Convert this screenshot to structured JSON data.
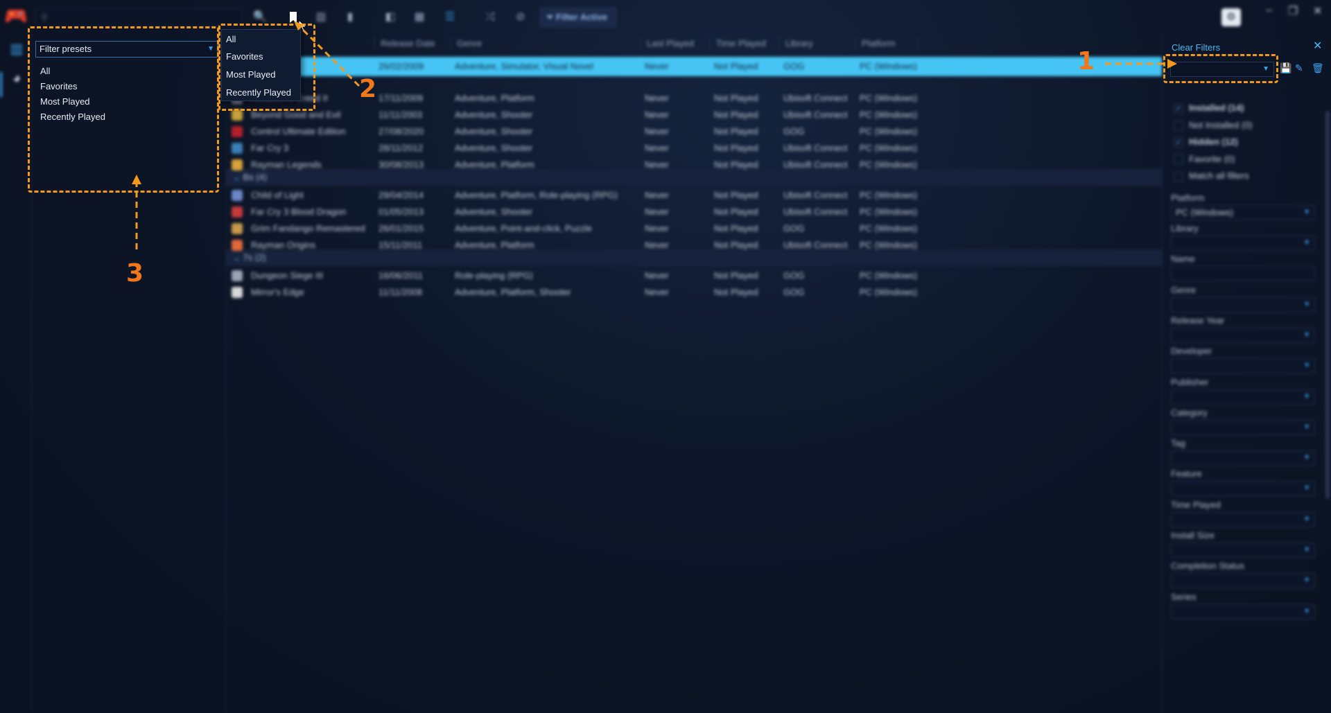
{
  "toolbar": {
    "filter_active_label": "Filter Active"
  },
  "grid": {
    "columns": [
      "Release Date",
      "Genre",
      "Last Played",
      "Time Played",
      "Library",
      "Platform"
    ],
    "groups": [
      {
        "label": "Bs (4)"
      },
      {
        "label": "7s (2)"
      }
    ],
    "selected_row": {
      "name": "… ROAM",
      "release": "26/02/2009",
      "genre": "Adventure, Simulator, Visual Novel",
      "last": "Never",
      "time": "Not Played",
      "library": "GOG",
      "platform": "PC (Windows)"
    },
    "rows_group1": [
      {
        "name": "Assassin's Creed II",
        "release": "17/11/2009",
        "genre": "Adventure, Platform",
        "last": "Never",
        "time": "Not Played",
        "library": "Ubisoft Connect",
        "platform": "PC (Windows)",
        "color": "#8c93a3"
      },
      {
        "name": "Beyond Good and Evil",
        "release": "11/11/2003",
        "genre": "Adventure, Shooter",
        "last": "Never",
        "time": "Not Played",
        "library": "Ubisoft Connect",
        "platform": "PC (Windows)",
        "color": "#c7a23a"
      },
      {
        "name": "Control Ultimate Edition",
        "release": "27/08/2020",
        "genre": "Adventure, Shooter",
        "last": "Never",
        "time": "Not Played",
        "library": "GOG",
        "platform": "PC (Windows)",
        "color": "#b3202a"
      },
      {
        "name": "Far Cry 3",
        "release": "28/11/2012",
        "genre": "Adventure, Shooter",
        "last": "Never",
        "time": "Not Played",
        "library": "Ubisoft Connect",
        "platform": "PC (Windows)",
        "color": "#3a7fb8"
      },
      {
        "name": "Rayman Legends",
        "release": "30/08/2013",
        "genre": "Adventure, Platform",
        "last": "Never",
        "time": "Not Played",
        "library": "Ubisoft Connect",
        "platform": "PC (Windows)",
        "color": "#d9a23a"
      }
    ],
    "rows_group2": [
      {
        "name": "Child of Light",
        "release": "29/04/2014",
        "genre": "Adventure, Platform, Role-playing (RPG)",
        "last": "Never",
        "time": "Not Played",
        "library": "Ubisoft Connect",
        "platform": "PC (Windows)",
        "color": "#6c86c7"
      },
      {
        "name": "Far Cry 3 Blood Dragon",
        "release": "01/05/2013",
        "genre": "Adventure, Shooter",
        "last": "Never",
        "time": "Not Played",
        "library": "Ubisoft Connect",
        "platform": "PC (Windows)",
        "color": "#c43a3a"
      },
      {
        "name": "Grim Fandango Remastered",
        "release": "26/01/2015",
        "genre": "Adventure, Point-and-click, Puzzle",
        "last": "Never",
        "time": "Not Played",
        "library": "GOG",
        "platform": "PC (Windows)",
        "color": "#c79a4a"
      },
      {
        "name": "Rayman Origins",
        "release": "15/11/2011",
        "genre": "Adventure, Platform",
        "last": "Never",
        "time": "Not Played",
        "library": "Ubisoft Connect",
        "platform": "PC (Windows)",
        "color": "#e06a3a"
      }
    ],
    "rows_group3": [
      {
        "name": "Dungeon Siege III",
        "release": "16/06/2011",
        "genre": "Role-playing (RPG)",
        "last": "Never",
        "time": "Not Played",
        "library": "GOG",
        "platform": "PC (Windows)",
        "color": "#9aa3b3"
      },
      {
        "name": "Mirror's Edge",
        "release": "11/11/2008",
        "genre": "Adventure, Platform, Shooter",
        "last": "Never",
        "time": "Not Played",
        "library": "GOG",
        "platform": "PC (Windows)",
        "color": "#d8d8d8"
      }
    ]
  },
  "filter_panel": {
    "clear_filters": "Clear Filters",
    "checks": [
      {
        "label": "Installed (14)",
        "checked": true
      },
      {
        "label": "Not Installed (0)",
        "checked": false
      },
      {
        "label": "Hidden (12)",
        "checked": true
      },
      {
        "label": "Favorite (0)",
        "checked": false
      },
      {
        "label": "Match all filters",
        "checked": false
      }
    ],
    "platform_label": "Platform",
    "platform_value": "PC (Windows)",
    "fields": [
      "Library",
      "Name",
      "Genre",
      "Release Year",
      "Developer",
      "Publisher",
      "Category",
      "Tag",
      "Feature",
      "Time Played",
      "Install Size",
      "Completion Status",
      "Series"
    ]
  },
  "preset_menu": {
    "items": [
      "All",
      "Favorites",
      "Most Played",
      "Recently Played"
    ]
  },
  "presets_panel": {
    "select_value": "Filter presets",
    "items": [
      "All",
      "Favorites",
      "Most Played",
      "Recently Played"
    ]
  },
  "annotations": {
    "n1": "1",
    "n2": "2",
    "n3": "3",
    "color": "#f39a1e"
  }
}
